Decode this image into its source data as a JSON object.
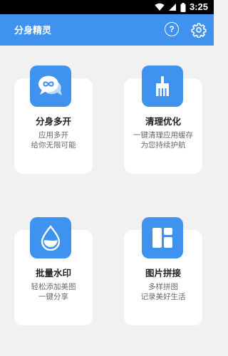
{
  "status_bar": {
    "time": "3:25",
    "icons": [
      "wifi-icon",
      "signal-icon",
      "battery-icon"
    ]
  },
  "app_bar": {
    "title": "分身精灵",
    "help_icon": "help-circle-icon",
    "settings_icon": "gear-icon",
    "background": "#3f93ef"
  },
  "features": [
    {
      "title": "分身多开",
      "desc_line1": "应用多开",
      "desc_line2": "给你无限可能",
      "icon": "chat-bubbles-icon"
    },
    {
      "title": "清理优化",
      "desc_line1": "一键清理应用缓存",
      "desc_line2": "为您持续护航",
      "icon": "broom-icon"
    },
    {
      "title": "批量水印",
      "desc_line1": "轻松添加美图",
      "desc_line2": "一键分享",
      "icon": "water-drop-icon"
    },
    {
      "title": "图片拼接",
      "desc_line1": "多样拼图",
      "desc_line2": "记录美好生活",
      "icon": "grid-layout-icon"
    }
  ],
  "colors": {
    "accent": "#3f93ef",
    "page_background": "#f1f1f1",
    "card_background": "#ffffff"
  }
}
